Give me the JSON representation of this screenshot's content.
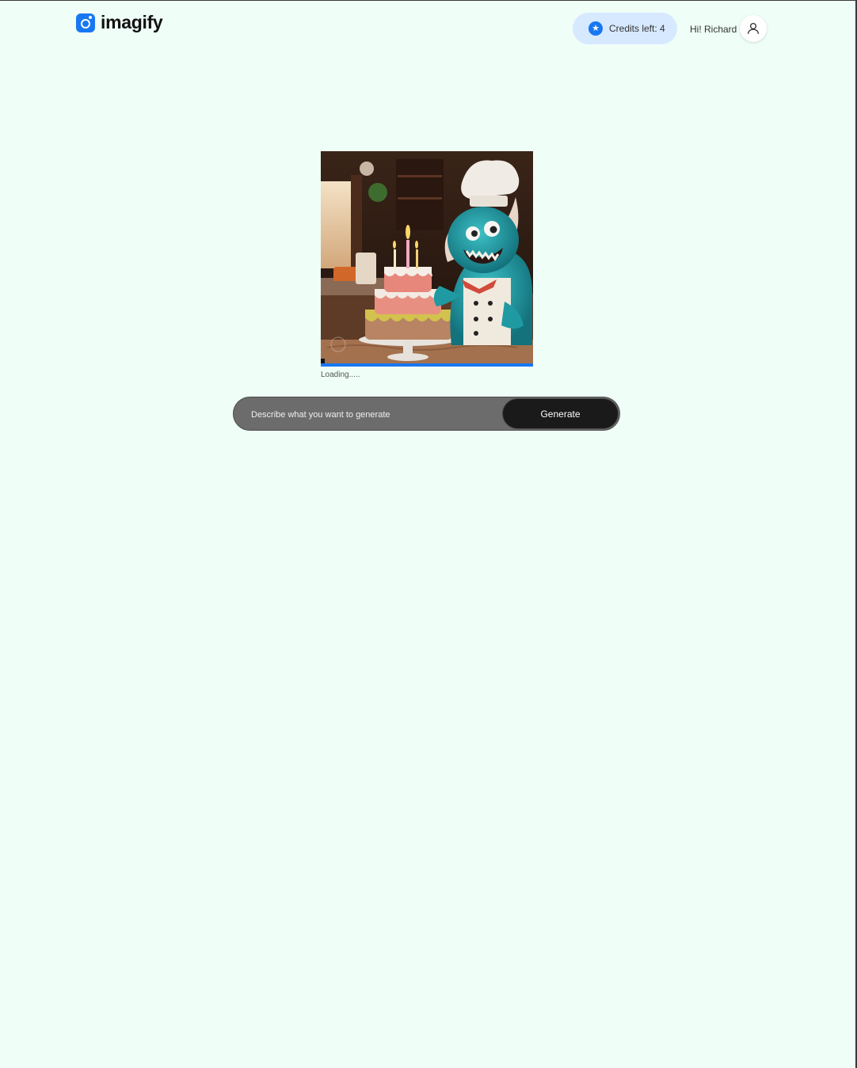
{
  "header": {
    "logo_text": "imagify",
    "credits_label": "Credits left: 4",
    "greeting": "Hi! Richard"
  },
  "result": {
    "image_alt": "Blue furry monster chef with birthday cake",
    "loading_text": "Loading.....",
    "progress_fraction": 1.0
  },
  "prompt": {
    "placeholder": "Describe what you want to generate",
    "value": "",
    "button_label": "Generate"
  },
  "colors": {
    "accent": "#1877f2",
    "background": "#effef7",
    "credits_bg": "#d7e9ff"
  }
}
